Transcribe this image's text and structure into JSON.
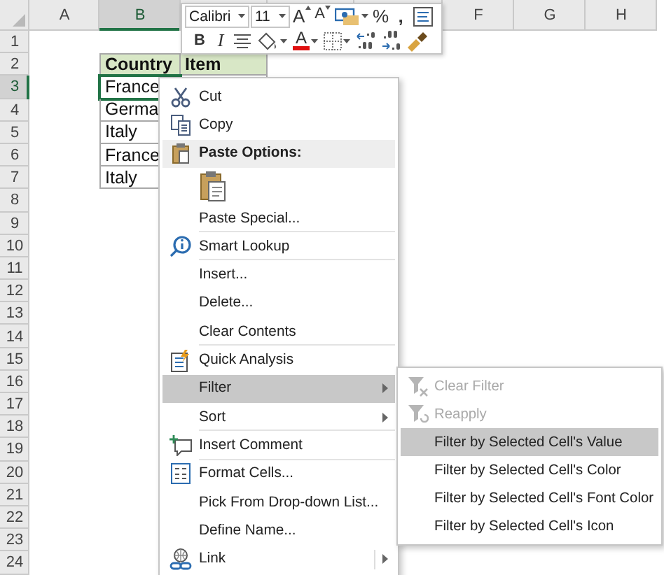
{
  "sheet": {
    "columns": [
      {
        "kind": "visible",
        "label": "A",
        "selected": false
      },
      {
        "kind": "visible",
        "label": "B",
        "selected": true
      },
      {
        "kind": "covered"
      },
      {
        "kind": "covered"
      },
      {
        "kind": "covered"
      },
      {
        "kind": "visible",
        "label": "F",
        "selected": false
      },
      {
        "kind": "visible",
        "label": "G",
        "selected": false
      },
      {
        "kind": "visible",
        "label": "H",
        "selected": false
      }
    ],
    "rows": [
      {
        "label": "1",
        "selected": false
      },
      {
        "label": "2",
        "selected": false
      },
      {
        "label": "3",
        "selected": true
      },
      {
        "label": "4",
        "selected": false
      },
      {
        "label": "5",
        "selected": false
      },
      {
        "label": "6",
        "selected": false
      },
      {
        "label": "7",
        "selected": false
      },
      {
        "label": "8",
        "selected": false
      },
      {
        "label": "9",
        "selected": false
      },
      {
        "label": "10",
        "selected": false
      },
      {
        "label": "11",
        "selected": false
      },
      {
        "label": "12",
        "selected": false
      },
      {
        "label": "13",
        "selected": false
      },
      {
        "label": "14",
        "selected": false
      },
      {
        "label": "15",
        "selected": false
      },
      {
        "label": "16",
        "selected": false
      },
      {
        "label": "17",
        "selected": false
      },
      {
        "label": "18",
        "selected": false
      },
      {
        "label": "19",
        "selected": false
      },
      {
        "label": "20",
        "selected": false
      },
      {
        "label": "21",
        "selected": false
      },
      {
        "label": "22",
        "selected": false
      },
      {
        "label": "23",
        "selected": false
      },
      {
        "label": "24",
        "selected": false
      }
    ],
    "table": {
      "columns": [
        "Country",
        "Item"
      ],
      "rows": [
        {
          "country": "France",
          "active": true
        },
        {
          "country": "Germa",
          "active": false
        },
        {
          "country": "Italy",
          "active": false
        },
        {
          "country": "France",
          "active": false
        },
        {
          "country": "Italy",
          "active": false
        }
      ]
    }
  },
  "mini_toolbar": {
    "row_1": [
      {
        "kind": "font_field",
        "value": "Calibri"
      },
      {
        "kind": "size_field",
        "value": "11"
      },
      {
        "kind": "grow_font",
        "label": "A",
        "dropdown": false
      },
      {
        "kind": "shrink_font",
        "label": "A",
        "dropdown": false
      },
      {
        "kind": "accounting",
        "dropdown": true
      },
      {
        "kind": "text",
        "label": "%",
        "dropdown": false
      },
      {
        "kind": "comma",
        "label": ",",
        "dropdown": false
      },
      {
        "kind": "wrap",
        "dropdown": false
      }
    ],
    "row_2": [
      {
        "kind": "bold",
        "label": "B",
        "dropdown": false
      },
      {
        "kind": "italic",
        "label": "I",
        "dropdown": false
      },
      {
        "kind": "center",
        "dropdown": false
      },
      {
        "kind": "fill",
        "dropdown": true
      },
      {
        "kind": "font_color",
        "label": "A",
        "dropdown": true
      },
      {
        "kind": "borders",
        "dropdown": true
      },
      {
        "kind": "increase_decimal",
        "dropdown": false
      },
      {
        "kind": "decrease_decimal",
        "dropdown": false
      },
      {
        "kind": "painter",
        "dropdown": false
      }
    ]
  },
  "context_menu": {
    "items": [
      {
        "kind": "cut",
        "label": "Cut",
        "selected": false,
        "submenu": false,
        "separator": false
      },
      {
        "kind": "copy",
        "label": "Copy",
        "selected": false,
        "submenu": false,
        "separator": false
      },
      {
        "kind": "header",
        "label": "Paste Options:"
      },
      {
        "kind": "paste_button"
      },
      {
        "kind": "plain",
        "label": "Paste Special...",
        "selected": false,
        "submenu": false,
        "separator": true
      },
      {
        "kind": "lookup",
        "label": "Smart Lookup",
        "selected": false,
        "submenu": false,
        "separator": true
      },
      {
        "kind": "plain",
        "label": "Insert...",
        "selected": false,
        "submenu": false,
        "separator": false
      },
      {
        "kind": "plain",
        "label": "Delete...",
        "selected": false,
        "submenu": false,
        "separator": false
      },
      {
        "kind": "plain",
        "label": "Clear Contents",
        "selected": false,
        "submenu": false,
        "separator": true
      },
      {
        "kind": "analysis",
        "label": "Quick Analysis",
        "selected": false,
        "submenu": false,
        "separator": false
      },
      {
        "kind": "plain",
        "label": "Filter",
        "selected": true,
        "submenu": true,
        "separator": false
      },
      {
        "kind": "plain",
        "label": "Sort",
        "selected": false,
        "submenu": true,
        "separator": true
      },
      {
        "kind": "comment",
        "label": "Insert Comment",
        "selected": false,
        "submenu": false,
        "separator": true
      },
      {
        "kind": "format",
        "label": "Format Cells...",
        "selected": false,
        "submenu": false,
        "separator": false
      },
      {
        "kind": "plain",
        "label": "Pick From Drop-down List...",
        "selected": false,
        "submenu": false,
        "separator": false
      },
      {
        "kind": "plain",
        "label": "Define Name...",
        "selected": false,
        "submenu": false,
        "separator": false
      },
      {
        "kind": "link",
        "label": "Link",
        "selected": false,
        "submenu": true,
        "separator": false
      }
    ]
  },
  "submenu": {
    "items": [
      {
        "kind": "clear_filter",
        "label": "Clear Filter",
        "disabled": true,
        "selected": false
      },
      {
        "kind": "reapply",
        "label": "Reapply",
        "disabled": true,
        "selected": false
      },
      {
        "kind": "plain",
        "label": "Filter by Selected Cell's Value",
        "disabled": false,
        "selected": true
      },
      {
        "kind": "plain",
        "label": "Filter by Selected Cell's Color",
        "disabled": false,
        "selected": false
      },
      {
        "kind": "plain",
        "label": "Filter by Selected Cell's Font Color",
        "disabled": false,
        "selected": false
      },
      {
        "kind": "plain",
        "label": "Filter by Selected Cell's Icon",
        "disabled": false,
        "selected": false
      }
    ]
  }
}
